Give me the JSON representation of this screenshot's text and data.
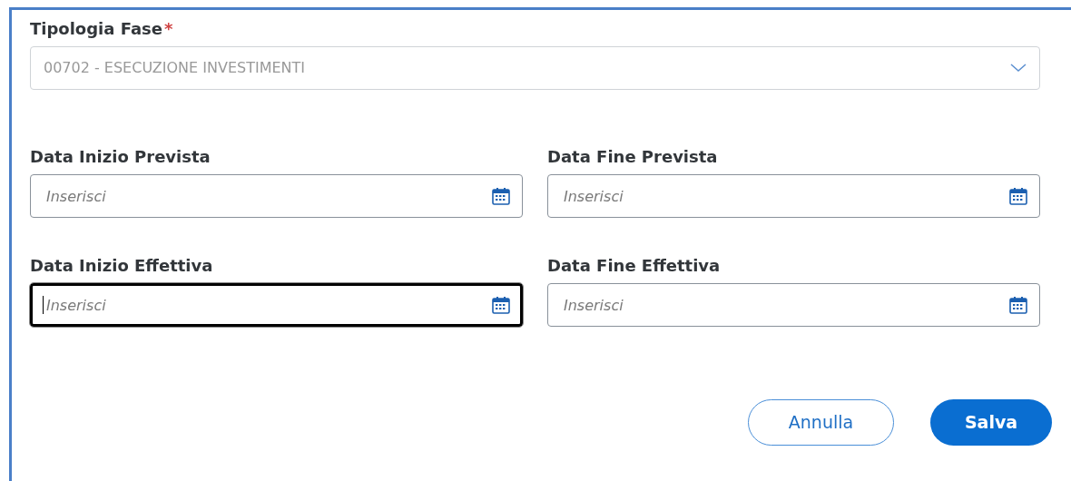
{
  "phase_type": {
    "label": "Tipologia Fase",
    "required": true,
    "required_mark": "*",
    "value": "00702 - ESECUZIONE INVESTIMENTI",
    "disabled": true
  },
  "date_fields": [
    {
      "label": "Data Inizio Prevista",
      "placeholder": "Inserisci",
      "focused": false
    },
    {
      "label": "Data Fine Prevista",
      "placeholder": "Inserisci",
      "focused": false
    },
    {
      "label": "Data Inizio Effettiva",
      "placeholder": "Inserisci",
      "focused": true
    },
    {
      "label": "Data Fine Effettiva",
      "placeholder": "Inserisci",
      "focused": false
    }
  ],
  "buttons": [
    {
      "label": "Annulla",
      "kind": "secondary"
    },
    {
      "label": "Salva",
      "kind": "primary"
    }
  ]
}
